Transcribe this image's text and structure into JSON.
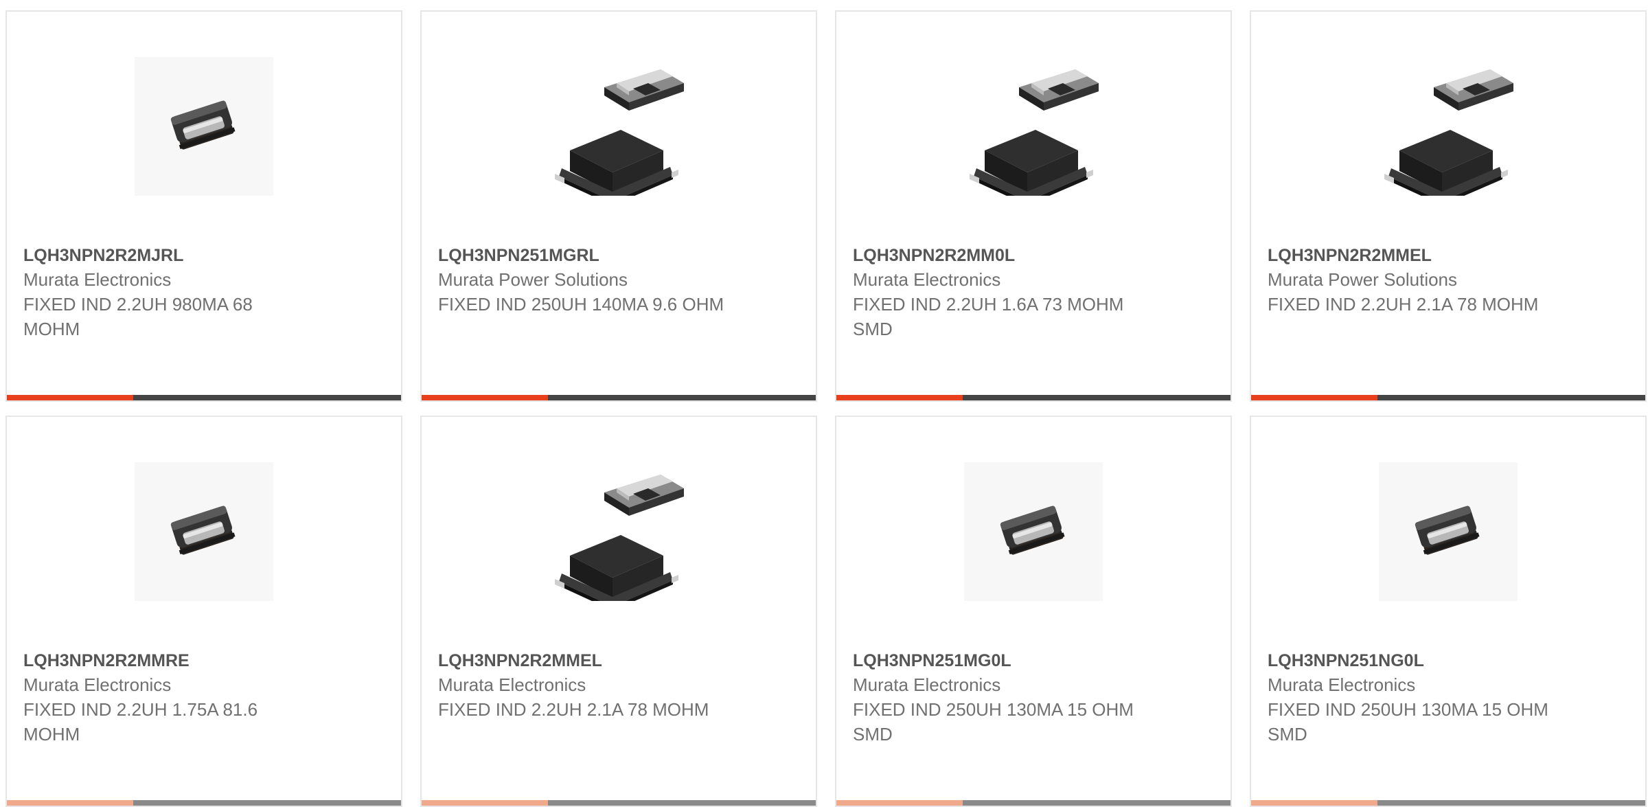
{
  "colors": {
    "accent": "#e8401c",
    "bar": "#444444",
    "title_text": "#555555",
    "body_text": "#707070",
    "card_border": "#e6e6e6"
  },
  "products": [
    {
      "part": "LQH3NPN2R2MJRL",
      "manufacturer": "Murata Electronics",
      "description": "FIXED IND 2.2UH 980MA 68 MOHM",
      "image_icon": "small-inductor-icon",
      "progress": 0.32
    },
    {
      "part": "LQH3NPN251MGRL",
      "manufacturer": "Murata Power Solutions",
      "description": "FIXED IND 250UH 140MA 9.6 OHM",
      "image_icon": "power-inductor-icon",
      "progress": 0.32
    },
    {
      "part": "LQH3NPN2R2MM0L",
      "manufacturer": "Murata Electronics",
      "description": "FIXED IND 2.2UH 1.6A 73 MOHM SMD",
      "image_icon": "power-inductor-icon",
      "progress": 0.32
    },
    {
      "part": "LQH3NPN2R2MMEL",
      "manufacturer": "Murata Power Solutions",
      "description": "FIXED IND 2.2UH 2.1A 78 MOHM",
      "image_icon": "power-inductor-icon",
      "progress": 0.32
    },
    {
      "part": "LQH3NPN2R2MMRE",
      "manufacturer": "Murata Electronics",
      "description": "FIXED IND 2.2UH 1.75A 81.6 MOHM",
      "image_icon": "small-inductor-icon",
      "progress": 0.32
    },
    {
      "part": "LQH3NPN2R2MMEL",
      "manufacturer": "Murata Electronics",
      "description": "FIXED IND 2.2UH 2.1A 78 MOHM",
      "image_icon": "power-inductor-icon",
      "progress": 0.32
    },
    {
      "part": "LQH3NPN251MG0L",
      "manufacturer": "Murata Electronics",
      "description": "FIXED IND 250UH 130MA 15 OHM SMD",
      "image_icon": "small-inductor-icon",
      "progress": 0.32
    },
    {
      "part": "LQH3NPN251NG0L",
      "manufacturer": "Murata Electronics",
      "description": "FIXED IND 250UH 130MA 15 OHM SMD",
      "image_icon": "small-inductor-icon",
      "progress": 0.32
    }
  ]
}
